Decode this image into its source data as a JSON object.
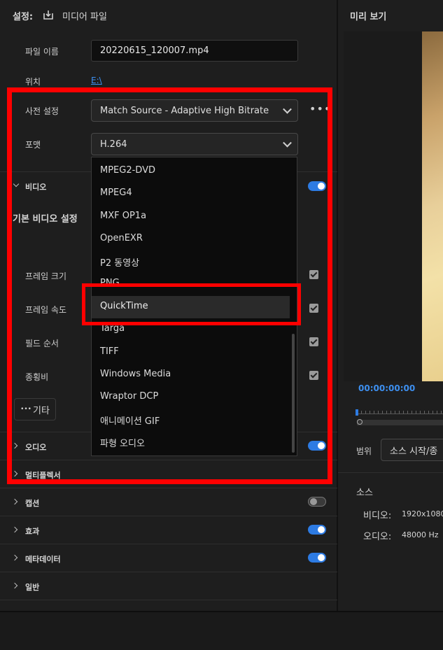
{
  "header": {
    "settings_label": "설정:",
    "media_file_label": "미디어 파일",
    "preview_title": "미리 보기"
  },
  "form": {
    "filename_label": "파일 이름",
    "filename_value": "20220615_120007.mp4",
    "location_label": "위치",
    "location_value": "E:\\",
    "preset_label": "사전 설정",
    "preset_value": "Match Source - Adaptive High Bitrate",
    "format_label": "포맷",
    "format_value": "H.264"
  },
  "dropdown": {
    "items": [
      "MPEG2-DVD",
      "MPEG4",
      "MXF OP1a",
      "OpenEXR",
      "P2 동영상",
      "PNG",
      "QuickTime",
      "Targa",
      "TIFF",
      "Windows Media",
      "Wraptor DCP",
      "애니메이션 GIF",
      "파형 오디오"
    ],
    "highlighted": "QuickTime"
  },
  "video": {
    "section_label": "비디오",
    "basic_settings_label": "기본 비디오 설정",
    "frame_size_label": "프레임 크기",
    "frame_rate_label": "프레임 속도",
    "field_order_label": "필드 순서",
    "aspect_label": "종횡비",
    "more_label": "기타"
  },
  "sections": {
    "audio": "오디오",
    "multiplexer": "멀티플렉서",
    "captions": "캡션",
    "effects": "효과",
    "metadata": "메타데이터",
    "general": "일반"
  },
  "preview": {
    "timecode": "00:00:00:00",
    "range_label": "범위",
    "range_value": "소스 시작/종",
    "source_title": "소스",
    "video_label": "비디오:",
    "video_value": "1920x1080",
    "audio_label": "오디오:",
    "audio_value": "48000 Hz"
  },
  "colors": {
    "accent": "#2d7be3",
    "highlight_box": "#ff0000",
    "timecode": "#3d8fef"
  },
  "icons": [
    "export-icon",
    "chevron-down-icon",
    "more-icon",
    "checkbox-icon",
    "toggle-icon",
    "caret-right-icon",
    "caret-down-icon"
  ]
}
